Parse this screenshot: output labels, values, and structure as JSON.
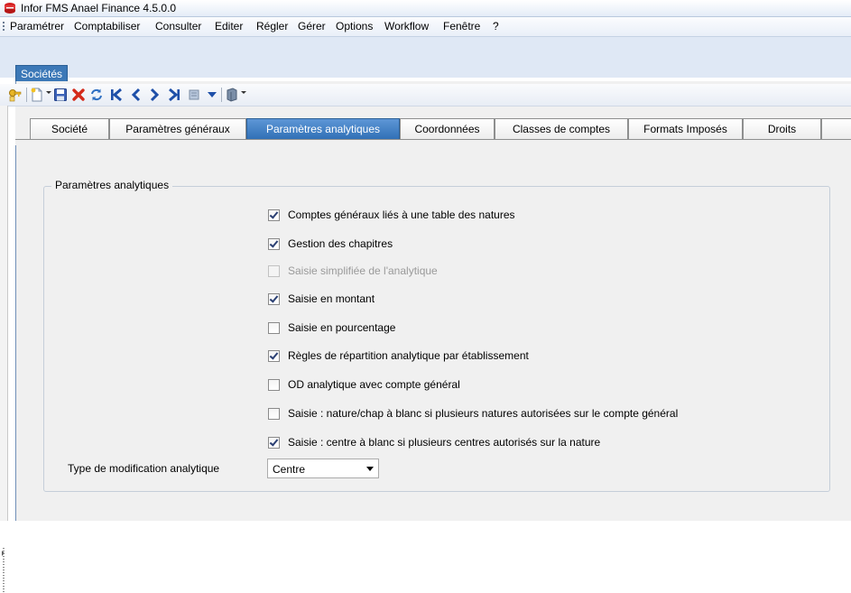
{
  "window": {
    "title": "Infor FMS Anael Finance 4.5.0.0",
    "app_icon": "anael-app-icon"
  },
  "menu": {
    "items": [
      "Paramétrer",
      "Comptabiliser",
      "Consulter",
      "Editer",
      "Régler",
      "Gérer",
      "Options",
      "Workflow",
      "Fenêtre",
      "?"
    ]
  },
  "mdi": {
    "tab_label": "Sociétés"
  },
  "toolbar": {
    "icons": [
      "key-icon",
      "new-document-icon",
      "save-icon",
      "delete-icon",
      "refresh-icon",
      "first-record-icon",
      "previous-record-icon",
      "next-record-icon",
      "last-record-icon",
      "filter-icon",
      "dropdown-arrow-icon",
      "export-icon"
    ]
  },
  "tabs": {
    "items": [
      "Société",
      "Paramètres généraux",
      "Paramètres analytiques",
      "Coordonnées",
      "Classes de comptes",
      "Formats Imposés",
      "Droits"
    ],
    "active": "Paramètres analytiques"
  },
  "group": {
    "legend": "Paramètres analytiques",
    "checkboxes": [
      {
        "label": "Comptes généraux liés à une table des natures",
        "checked": true,
        "disabled": false
      },
      {
        "label": "Gestion des chapitres",
        "checked": true,
        "disabled": false
      },
      {
        "label": "Saisie simplifiée de l'analytique",
        "checked": false,
        "disabled": true
      },
      {
        "label": "Saisie en montant",
        "checked": true,
        "disabled": false
      },
      {
        "label": "Saisie en pourcentage",
        "checked": false,
        "disabled": false
      },
      {
        "label": "Règles de répartition analytique par établissement",
        "checked": true,
        "disabled": false
      },
      {
        "label": "OD analytique avec compte général",
        "checked": false,
        "disabled": false
      },
      {
        "label": "Saisie : nature/chap à blanc si plusieurs natures autorisées sur le compte général",
        "checked": false,
        "disabled": false
      },
      {
        "label": "Saisie : centre à blanc si plusieurs centres autorisés sur la nature",
        "checked": true,
        "disabled": false
      }
    ],
    "type_label": "Type de modification analytique",
    "type_value": "Centre"
  },
  "colors": {
    "active_tab": "#3c78b7",
    "checkmark": "#2a3f73",
    "disabled_text": "#9a9a9a"
  }
}
